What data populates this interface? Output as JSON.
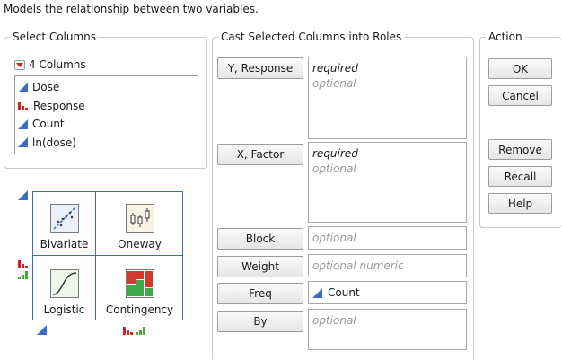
{
  "description": "Models the relationship between two variables.",
  "select_columns": {
    "legend": "Select Columns",
    "count_label": "4 Columns",
    "columns": [
      {
        "name": "Dose",
        "modeling_type": "continuous"
      },
      {
        "name": "Response",
        "modeling_type": "nominal"
      },
      {
        "name": "Count",
        "modeling_type": "continuous"
      },
      {
        "name": "ln(dose)",
        "modeling_type": "continuous"
      }
    ]
  },
  "cast_roles": {
    "legend": "Cast Selected Columns into Roles",
    "roles": [
      {
        "button": "Y, Response",
        "required": "required",
        "optional": "optional"
      },
      {
        "button": "X, Factor",
        "required": "required",
        "optional": "optional"
      },
      {
        "button": "Block",
        "optional": "optional"
      },
      {
        "button": "Weight",
        "optional": "optional numeric"
      },
      {
        "button": "Freq",
        "value": "Count"
      },
      {
        "button": "By",
        "optional": "optional"
      }
    ]
  },
  "action": {
    "legend": "Action",
    "buttons": [
      "OK",
      "Cancel",
      "Remove",
      "Recall",
      "Help"
    ]
  },
  "platform_grid": {
    "cells": [
      "Bivariate",
      "Oneway",
      "Logistic",
      "Contingency"
    ]
  },
  "colors": {
    "continuous_icon": "#3a6bc9",
    "nominal_icon": "#c8281e",
    "ordinal_icon": "#4aa53a",
    "grid_border": "#3a6bc9"
  }
}
